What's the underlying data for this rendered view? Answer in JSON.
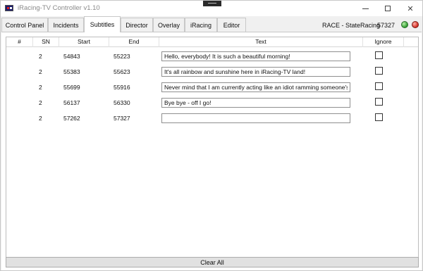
{
  "window": {
    "title": "iRacing-TV Controller v1.10",
    "minimize_glyph": "",
    "close_glyph": "✕"
  },
  "tabs": [
    {
      "label": "Control Panel",
      "active": false
    },
    {
      "label": "Incidents",
      "active": false
    },
    {
      "label": "Subtitles",
      "active": true
    },
    {
      "label": "Director",
      "active": false
    },
    {
      "label": "Overlay",
      "active": false
    },
    {
      "label": "iRacing",
      "active": false
    },
    {
      "label": "Editor",
      "active": false
    }
  ],
  "status": {
    "state": "RACE - StateRacing",
    "session_time": "57327",
    "indicators": [
      {
        "name": "green-status-light",
        "color": "#2f9a2f"
      },
      {
        "name": "red-status-light",
        "color": "#d02a20"
      }
    ]
  },
  "grid": {
    "columns": [
      "#",
      "SN",
      "Start",
      "End",
      "Text",
      "Ignore"
    ],
    "rows": [
      {
        "sn": "2",
        "start": "54843",
        "end": "55223",
        "text": "Hello, everybody! It is such a beautiful morning!",
        "ignore": false
      },
      {
        "sn": "2",
        "start": "55383",
        "end": "55623",
        "text": "It's all rainbow and sunshine here in iRacing-TV land!",
        "ignore": false
      },
      {
        "sn": "2",
        "start": "55699",
        "end": "55916",
        "text": "Never mind that I am currently acting like an idiot ramming someone's",
        "ignore": false
      },
      {
        "sn": "2",
        "start": "56137",
        "end": "56330",
        "text": "Bye bye - off I go!",
        "ignore": false
      },
      {
        "sn": "2",
        "start": "57262",
        "end": "57327",
        "text": "",
        "ignore": false
      }
    ]
  },
  "actions": {
    "clear_all": "Clear All"
  }
}
